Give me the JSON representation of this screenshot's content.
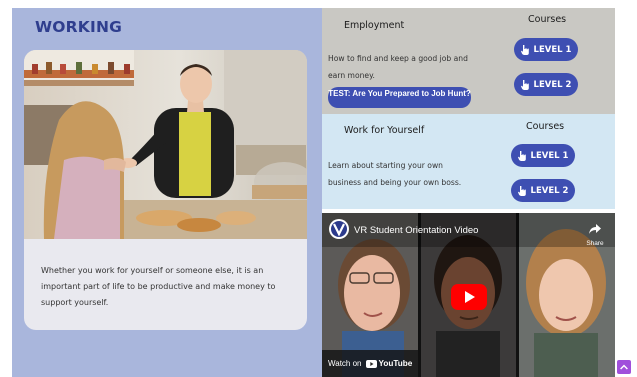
{
  "page": {
    "heading": "WORKING",
    "card_text": "Whether you work for yourself or someone else, it is an important part of life to be productive and make money to support yourself."
  },
  "employment": {
    "title": "Employment",
    "courses_label": "Courses",
    "description": "How to find and keep a good job and earn money.",
    "test_button": "TEST: Are You Prepared to Job Hunt?",
    "level1": "LEVEL 1",
    "level2": "LEVEL 2"
  },
  "self_employment": {
    "title": "Work for Yourself",
    "courses_label": "Courses",
    "description": "Learn about starting your own business and being your own boss.",
    "level1": "LEVEL 1",
    "level2": "LEVEL 2"
  },
  "video": {
    "title": "VR Student Orientation Video",
    "share_label": "Share",
    "watch_on": "Watch on",
    "youtube": "YouTube"
  },
  "colors": {
    "accent": "#3e4fb2",
    "heading": "#2f3e8e",
    "left_panel": "#a9b6dc",
    "employment_bg": "#c9c8c3",
    "self_employment_bg": "#d3e7f3",
    "scroll_top": "#a04fdb"
  },
  "icons": {
    "level_button": "pointing-hand-icon",
    "share": "share-arrow-icon",
    "play": "youtube-play-icon",
    "scroll": "chevron-up-icon"
  }
}
